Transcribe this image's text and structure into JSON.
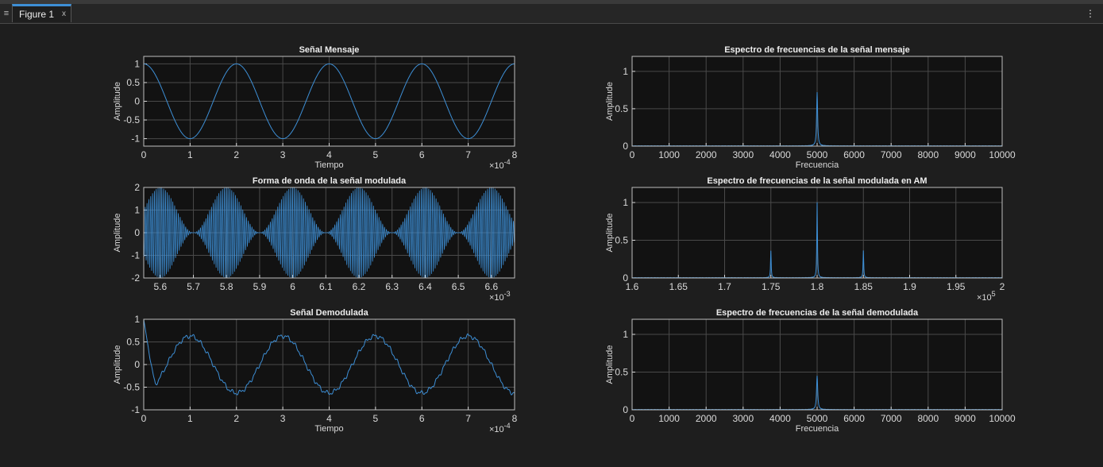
{
  "window": {
    "tab_title": "Figure 1",
    "close_glyph": "x",
    "menu_icon": "vertical-dots-icon"
  },
  "colors": {
    "axes_bg": "#121212",
    "grid": "#4a4a4a",
    "text": "#d9d9d9",
    "line": "#3d8fd6"
  },
  "chart_data": [
    {
      "id": "p1",
      "type": "line",
      "title": "Señal Mensaje",
      "xlabel": "Tiempo",
      "ylabel": "Amplitude",
      "xlim": [
        0,
        8
      ],
      "ylim": [
        -1.2,
        1.2
      ],
      "xticks": [
        0,
        1,
        2,
        3,
        4,
        5,
        6,
        7,
        8
      ],
      "xticklabels": [
        "0",
        "1",
        "2",
        "3",
        "4",
        "5",
        "6",
        "7",
        "8"
      ],
      "yticks": [
        -1,
        -0.5,
        0,
        0.5,
        1
      ],
      "yticklabels": [
        "-1",
        "-0.5",
        "0",
        "0.5",
        "1"
      ],
      "exponent": {
        "base": "×10",
        "power": "-4"
      },
      "series": [
        {
          "signal": "cosine",
          "amplitude": 1,
          "period": 2
        }
      ]
    },
    {
      "id": "p2",
      "type": "line",
      "title": "Espectro de frecuencias de la señal mensaje",
      "xlabel": "Frecuencia",
      "ylabel": "Amplitude",
      "xlim": [
        0,
        10000
      ],
      "ylim": [
        0,
        1.2
      ],
      "xticks": [
        0,
        1000,
        2000,
        3000,
        4000,
        5000,
        6000,
        7000,
        8000,
        9000,
        10000
      ],
      "xticklabels": [
        "0",
        "1000",
        "2000",
        "3000",
        "4000",
        "5000",
        "6000",
        "7000",
        "8000",
        "9000",
        "10000"
      ],
      "yticks": [
        0,
        0.5,
        1
      ],
      "yticklabels": [
        "0",
        "0.5",
        "1"
      ],
      "series": [
        {
          "signal": "peaks",
          "peaks": [
            {
              "x": 5000,
              "y": 0.72,
              "width": 40
            }
          ]
        }
      ]
    },
    {
      "id": "p3",
      "type": "line",
      "title": "Forma de onda de la señal modulada",
      "xlabel": "",
      "ylabel": "Amplitude",
      "xlim": [
        5.55,
        6.67
      ],
      "ylim": [
        -2,
        2
      ],
      "xticks": [
        5.6,
        5.7,
        5.8,
        5.9,
        6.0,
        6.1,
        6.2,
        6.3,
        6.4,
        6.5,
        6.6
      ],
      "xticklabels": [
        "5.6",
        "5.7",
        "5.8",
        "5.9",
        "6",
        "6.1",
        "6.2",
        "6.3",
        "6.4",
        "6.5",
        "6.6"
      ],
      "yticks": [
        -2,
        -1,
        0,
        1,
        2
      ],
      "yticklabels": [
        "-2",
        "-1",
        "0",
        "1",
        "2"
      ],
      "exponent": {
        "base": "×10",
        "power": "-3"
      },
      "series": [
        {
          "signal": "am",
          "amplitude": 1,
          "message_period": 0.2,
          "carrier_period": 0.00556
        }
      ]
    },
    {
      "id": "p4",
      "type": "line",
      "title": "Espectro de frecuencias de la señal modulada en AM",
      "xlabel": "",
      "ylabel": "Amplitude",
      "xlim": [
        1.6,
        2.0
      ],
      "ylim": [
        0,
        1.2
      ],
      "xticks": [
        1.6,
        1.65,
        1.7,
        1.75,
        1.8,
        1.85,
        1.9,
        1.95,
        2.0
      ],
      "xticklabels": [
        "1.6",
        "1.65",
        "1.7",
        "1.75",
        "1.8",
        "1.85",
        "1.9",
        "1.95",
        "2"
      ],
      "yticks": [
        0,
        0.5,
        1
      ],
      "yticklabels": [
        "0",
        "0.5",
        "1"
      ],
      "exponent": {
        "base": "×10",
        "power": "5"
      },
      "series": [
        {
          "signal": "peaks",
          "peaks": [
            {
              "x": 1.75,
              "y": 0.36,
              "width": 0.001
            },
            {
              "x": 1.8,
              "y": 1.0,
              "width": 0.001
            },
            {
              "x": 1.85,
              "y": 0.36,
              "width": 0.001
            }
          ]
        }
      ]
    },
    {
      "id": "p5",
      "type": "line",
      "title": "Señal Demodulada",
      "xlabel": "Tiempo",
      "ylabel": "Amplitude",
      "xlim": [
        0,
        8
      ],
      "ylim": [
        -1,
        1
      ],
      "xticks": [
        0,
        1,
        2,
        3,
        4,
        5,
        6,
        7,
        8
      ],
      "xticklabels": [
        "0",
        "1",
        "2",
        "3",
        "4",
        "5",
        "6",
        "7",
        "8"
      ],
      "yticks": [
        -1,
        -0.5,
        0,
        0.5,
        1
      ],
      "yticklabels": [
        "-1",
        "-0.5",
        "0",
        "0.5",
        "1"
      ],
      "exponent": {
        "base": "×10",
        "power": "-4"
      },
      "series": [
        {
          "signal": "demod",
          "amplitude": 0.63,
          "period": 2,
          "start_value": 1.0
        }
      ]
    },
    {
      "id": "p6",
      "type": "line",
      "title": "Espectro de frecuencias de la señal demodulada",
      "xlabel": "Frecuencia",
      "ylabel": "Amplitude",
      "xlim": [
        0,
        10000
      ],
      "ylim": [
        0,
        1.2
      ],
      "xticks": [
        0,
        1000,
        2000,
        3000,
        4000,
        5000,
        6000,
        7000,
        8000,
        9000,
        10000
      ],
      "xticklabels": [
        "0",
        "1000",
        "2000",
        "3000",
        "4000",
        "5000",
        "6000",
        "7000",
        "8000",
        "9000",
        "10000"
      ],
      "yticks": [
        0,
        0.5,
        1
      ],
      "yticklabels": [
        "0",
        "0.5",
        "1"
      ],
      "series": [
        {
          "signal": "peaks",
          "peaks": [
            {
              "x": 5000,
              "y": 0.45,
              "width": 45
            }
          ]
        }
      ]
    }
  ]
}
